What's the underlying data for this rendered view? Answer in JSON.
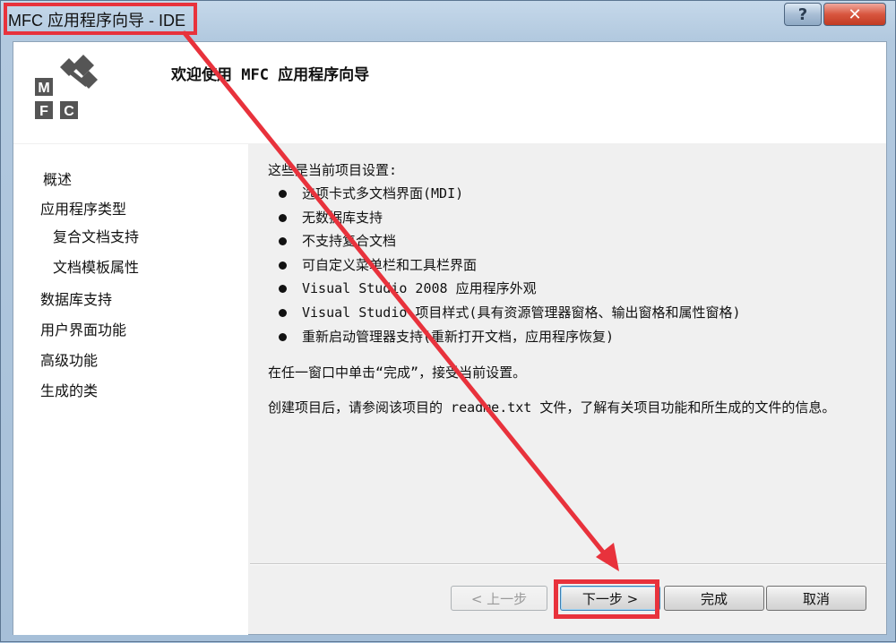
{
  "window": {
    "title": "MFC 应用程序向导 - IDE",
    "help_label": "?",
    "close_label": "✕"
  },
  "banner": {
    "logo_letters": [
      "M",
      "F",
      "C"
    ],
    "title": "欢迎使用 MFC 应用程序向导"
  },
  "nav": {
    "items": [
      {
        "label": "概述"
      },
      {
        "label": "应用程序类型"
      },
      {
        "label": "复合文档支持"
      },
      {
        "label": "文档模板属性"
      },
      {
        "label": "数据库支持"
      },
      {
        "label": "用户界面功能"
      },
      {
        "label": "高级功能"
      },
      {
        "label": "生成的类"
      }
    ]
  },
  "content": {
    "intro": "这些是当前项目设置:",
    "bullets": [
      "选项卡式多文档界面(MDI)",
      "无数据库支持",
      "不支持复合文档",
      "可自定义菜单栏和工具栏界面",
      "Visual Studio 2008 应用程序外观",
      "Visual Studio 项目样式(具有资源管理器窗格、输出窗格和属性窗格)",
      "重新启动管理器支持(重新打开文档，应用程序恢复)"
    ],
    "para1": "在任一窗口中单击“完成”，接受当前设置。",
    "para2": "创建项目后，请参阅该项目的 readme.txt 文件，了解有关项目功能和所生成的文件的信息。"
  },
  "buttons": {
    "prev": "< 上一步",
    "next": "下一步 >",
    "finish": "完成",
    "cancel": "取消"
  },
  "colors": {
    "annotation": "#e8323c"
  }
}
